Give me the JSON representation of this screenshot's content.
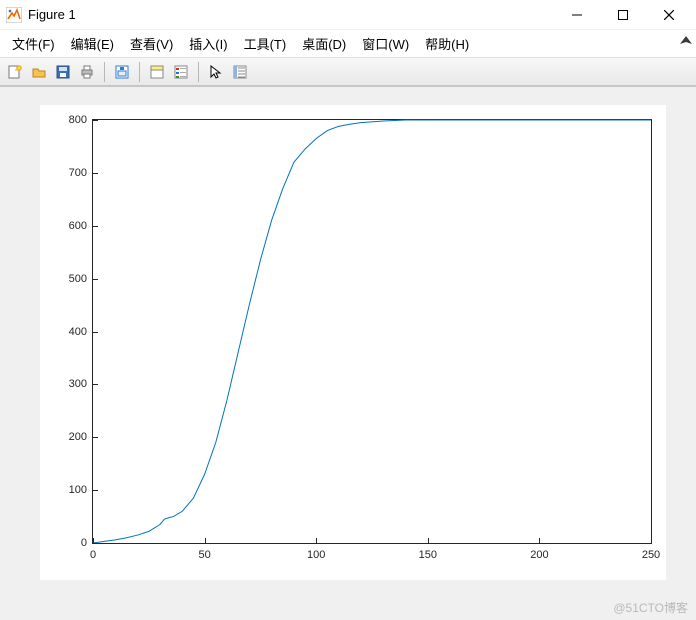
{
  "window": {
    "title": "Figure 1"
  },
  "menu": {
    "items": [
      "文件(F)",
      "编辑(E)",
      "查看(V)",
      "插入(I)",
      "工具(T)",
      "桌面(D)",
      "窗口(W)",
      "帮助(H)"
    ]
  },
  "toolbar": {
    "icons": [
      "new-figure-icon",
      "open-icon",
      "save-icon",
      "print-icon",
      "|",
      "page-setup-icon",
      "|",
      "inspector-icon",
      "legend-icon",
      "|",
      "cursor-icon",
      "brush-icon"
    ]
  },
  "watermark": "@51CTO博客",
  "chart_data": {
    "type": "line",
    "xlim": [
      0,
      250
    ],
    "ylim": [
      0,
      800
    ],
    "xticks": [
      0,
      50,
      100,
      150,
      200,
      250
    ],
    "yticks": [
      0,
      100,
      200,
      300,
      400,
      500,
      600,
      700,
      800
    ],
    "line_color": "#0072BD",
    "x": [
      0,
      5,
      10,
      15,
      20,
      25,
      30,
      32,
      34,
      36,
      40,
      45,
      50,
      55,
      60,
      65,
      70,
      75,
      80,
      85,
      90,
      95,
      100,
      105,
      110,
      115,
      120,
      130,
      140,
      160,
      180,
      200,
      220,
      240,
      250
    ],
    "y": [
      0,
      3,
      6,
      10,
      15,
      22,
      35,
      45,
      48,
      50,
      60,
      85,
      130,
      190,
      270,
      360,
      450,
      535,
      610,
      670,
      720,
      745,
      765,
      780,
      788,
      792,
      795,
      798,
      800,
      800,
      800,
      800,
      800,
      800,
      800
    ]
  }
}
